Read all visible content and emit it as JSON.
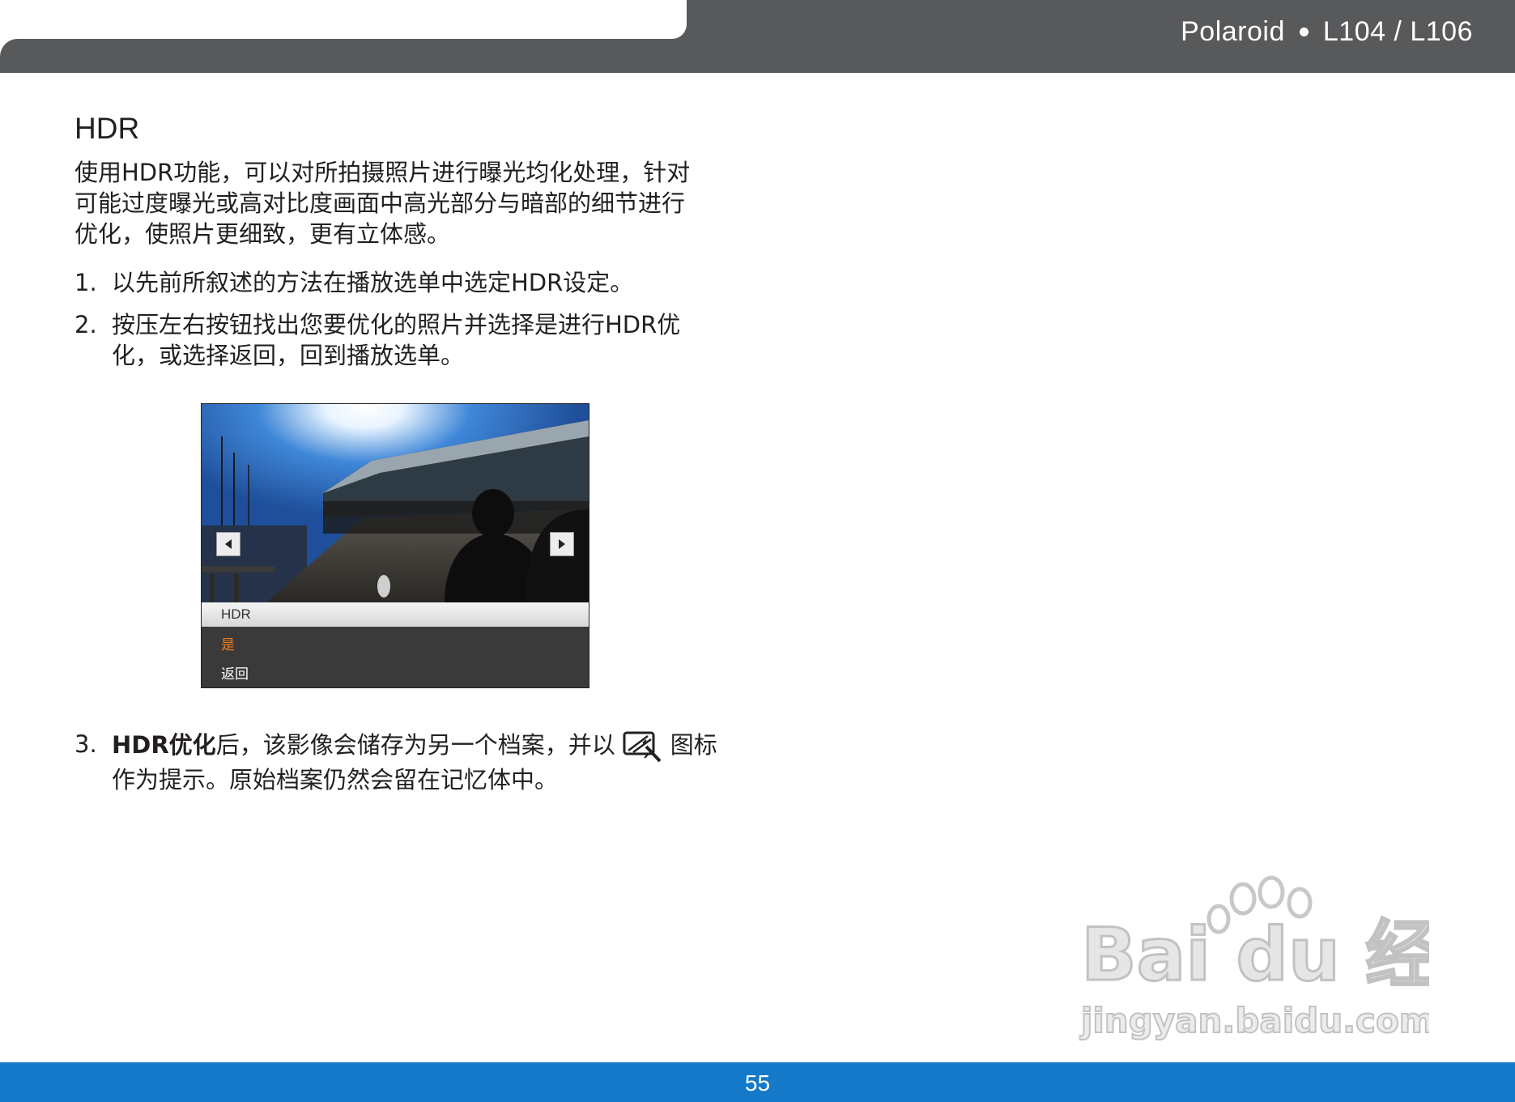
{
  "header": {
    "brand": "Polaroid",
    "model": "L104 / L106"
  },
  "section": {
    "title": "HDR",
    "intro": "使用HDR功能，可以对所拍摄照片进行曝光均化处理，针对可能过度曝光或高对比度画面中高光部分与暗部的细节进行优化，使照片更细致，更有立体感。"
  },
  "steps": [
    {
      "num": "1.",
      "text": "以先前所叙述的方法在播放选单中选定HDR设定。"
    },
    {
      "num": "2.",
      "text": "按压左右按钮找出您要优化的照片并选择是进行HDR优化，或选择返回，回到播放选单。"
    },
    {
      "num": "3.",
      "bold": "HDR优化",
      "text_before_icon": "后，该影像会储存为另一个档案，并以",
      "text_after_icon": "图标作为提示。原始档案仍然会留在记忆体中。"
    }
  ],
  "camera_screen": {
    "menu_title": "HDR",
    "option_yes": "是",
    "option_back": "返回",
    "highlight_color": "#f07d1a"
  },
  "footer": {
    "page_number": "55",
    "color": "#1479c9"
  },
  "watermark": {
    "text_main": "Bai du 经验",
    "text_url": "jingyan.baidu.com"
  },
  "icons": [
    "arrow-left-icon",
    "arrow-right-icon",
    "hdr-icon"
  ]
}
